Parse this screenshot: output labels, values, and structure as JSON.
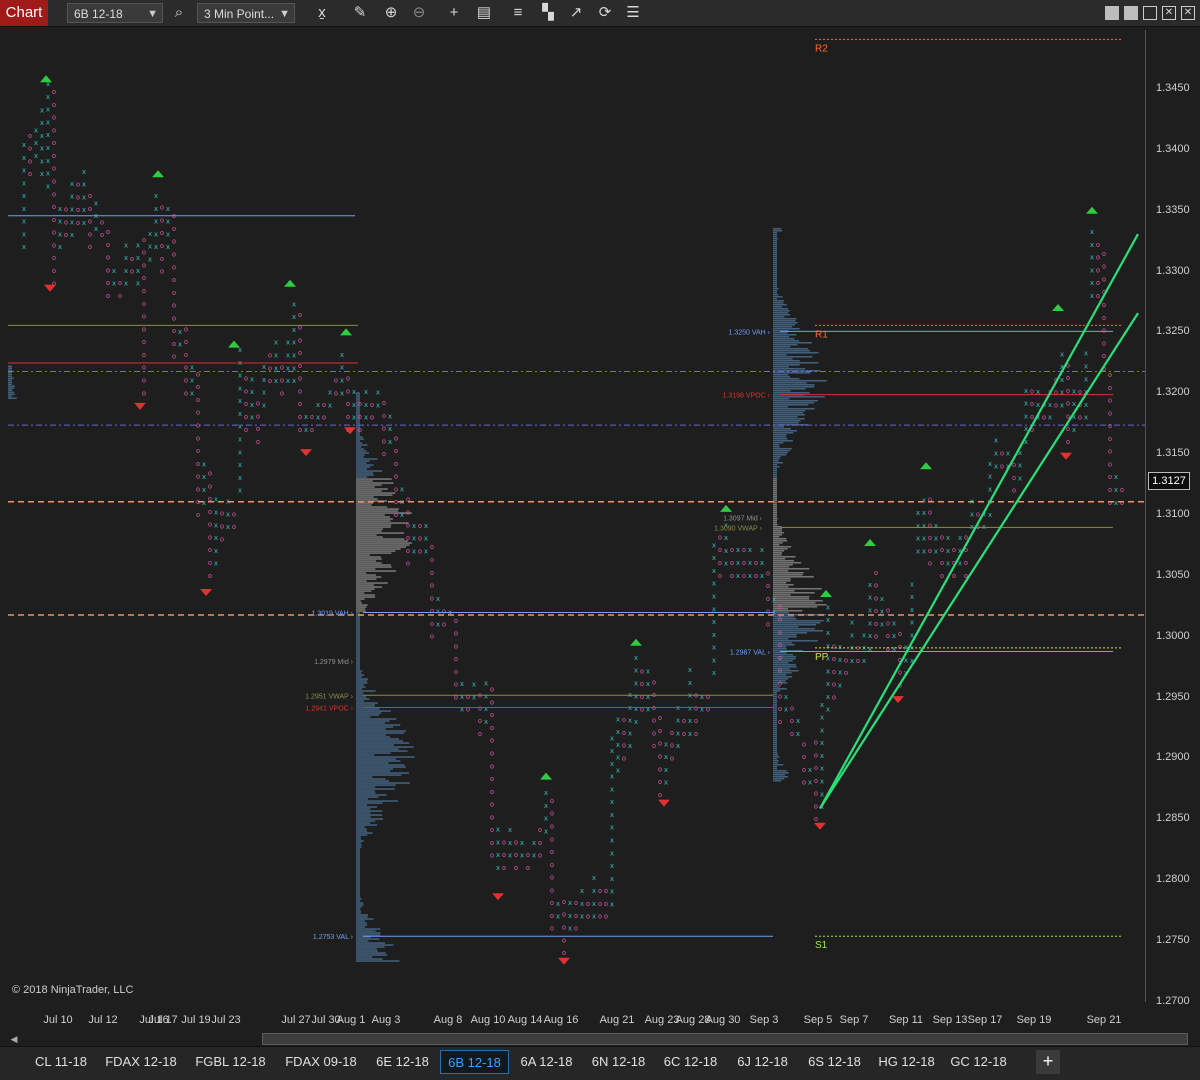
{
  "toolbar": {
    "chart_tab": "Chart",
    "instrument": "6B 12-18",
    "period": "3 Min Point...",
    "icons": [
      "search-icon",
      "bar-type-icon",
      "draw-icon",
      "zoom-in-icon",
      "zoom-out-icon",
      "crosshair-icon",
      "data-box-icon",
      "indicators-icon",
      "strategies-icon",
      "drawing-tools-icon",
      "refresh-icon",
      "properties-icon"
    ],
    "window_buttons": [
      "minimize-icon",
      "restore-icon",
      "maximize-icon",
      "close-icon"
    ]
  },
  "chart_data": {
    "type": "point-and-figure",
    "instrument": "6B 12-18",
    "y_ticks": [
      "1.3450",
      "1.3400",
      "1.3350",
      "1.3300",
      "1.3250",
      "1.3200",
      "1.3150",
      "1.3100",
      "1.3050",
      "1.3000",
      "1.2950",
      "1.2900",
      "1.2850",
      "1.2800",
      "1.2750",
      "1.2700"
    ],
    "x_ticks": [
      "Jul 10",
      "Jul 12",
      "Jul 16",
      "Jul 17",
      "Jul 19",
      "Jul 23",
      "Jul 27",
      "Jul 30",
      "Aug 1",
      "Aug 3",
      "Aug 8",
      "Aug 10",
      "Aug 14",
      "Aug 16",
      "Aug 21",
      "Aug 23",
      "Aug 28",
      "Aug 30",
      "Sep 3",
      "Sep 5",
      "Sep 7",
      "Sep 11",
      "Sep 13",
      "Sep 17",
      "Sep 19",
      "Sep 21"
    ],
    "last_price": "1.3127",
    "levels": [
      {
        "label": "R2",
        "price": 1.349,
        "color": "#ff6a2a"
      },
      {
        "label": "R1",
        "price": 1.3255,
        "color": "#ff6a2a"
      },
      {
        "label": "PP",
        "price": 1.299,
        "color": "#cfe04a"
      },
      {
        "label": "S1",
        "price": 1.2753,
        "color": "#a0e040"
      }
    ],
    "profile_labels": [
      {
        "text": "1.3250 VAH",
        "price": 1.325
      },
      {
        "text": "1.3198 VPOC",
        "price": 1.3198
      },
      {
        "text": "1.3097 Mid",
        "price": 1.3097
      },
      {
        "text": "1.3090 VWAP",
        "price": 1.3089
      },
      {
        "text": "1.2987 VAL",
        "price": 1.2987
      },
      {
        "text": "1.3019 VAH",
        "price": 1.3019
      },
      {
        "text": "1.2979 Mid",
        "price": 1.2979
      },
      {
        "text": "1.2951 VWAP",
        "price": 1.2951
      },
      {
        "text": "1.2941 VPOC",
        "price": 1.2941
      },
      {
        "text": "1.2753 VAL",
        "price": 1.2753
      }
    ],
    "dashed_levels": [
      1.311,
      1.3017
    ],
    "dash_dot_levels": [
      1.3217,
      1.3173
    ],
    "colors": {
      "x": "#35c4c4",
      "o": "#e05aa8",
      "up_marker": "#2ecc40",
      "down_marker": "#e33030",
      "trend": "#28e07a"
    }
  },
  "copyright": "© 2018 NinjaTrader, LLC",
  "tabs": [
    {
      "label": "CL 11-18"
    },
    {
      "label": "FDAX 12-18"
    },
    {
      "label": "FGBL 12-18"
    },
    {
      "label": "FDAX 09-18"
    },
    {
      "label": "6E 12-18"
    },
    {
      "label": "6B 12-18",
      "active": true
    },
    {
      "label": "6A 12-18"
    },
    {
      "label": "6N 12-18"
    },
    {
      "label": "6C 12-18"
    },
    {
      "label": "6J 12-18"
    },
    {
      "label": "6S 12-18"
    },
    {
      "label": "HG 12-18"
    },
    {
      "label": "GC 12-18"
    }
  ]
}
